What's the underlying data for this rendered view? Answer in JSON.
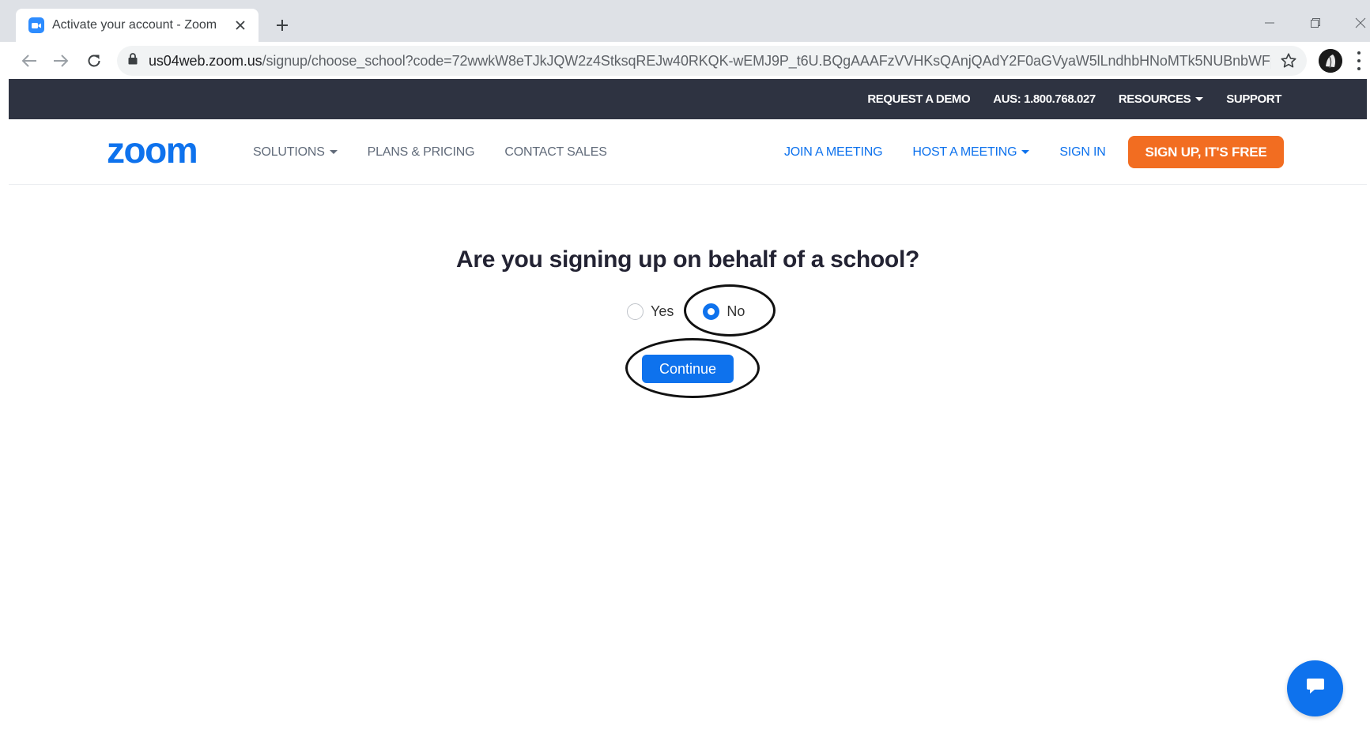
{
  "browser": {
    "tab_title": "Activate your account - Zoom",
    "url_host": "us04web.zoom.us",
    "url_path": "/signup/choose_school?code=72wwkW8eTJkJQW2z4StksqREJw40RKQK-wEMJ9P_t6U.BQgAAAFzVVHKsQAnjQAdY2F0aGVyaW5lLndhbHNoMTk5NUBnbWFpbC5..."
  },
  "topbar": {
    "request_demo": "REQUEST A DEMO",
    "phone": "AUS: 1.800.768.027",
    "resources": "RESOURCES",
    "support": "SUPPORT"
  },
  "nav": {
    "logo_text": "zoom",
    "solutions": "SOLUTIONS",
    "plans_pricing": "PLANS & PRICING",
    "contact_sales": "CONTACT SALES",
    "join_meeting": "JOIN A MEETING",
    "host_meeting": "HOST A MEETING",
    "sign_in": "SIGN IN",
    "sign_up": "SIGN UP, IT'S FREE"
  },
  "form": {
    "question": "Are you signing up on behalf of a school?",
    "options": [
      {
        "label": "Yes",
        "checked": false
      },
      {
        "label": "No",
        "checked": true
      }
    ],
    "continue_label": "Continue"
  },
  "colors": {
    "topbar_bg": "#2e3341",
    "zoom_blue": "#0e72ed",
    "signup_orange": "#f26d21"
  },
  "icons": {
    "tab_favicon": "zoom-camera-icon",
    "chat": "chat-bubble-icon"
  }
}
